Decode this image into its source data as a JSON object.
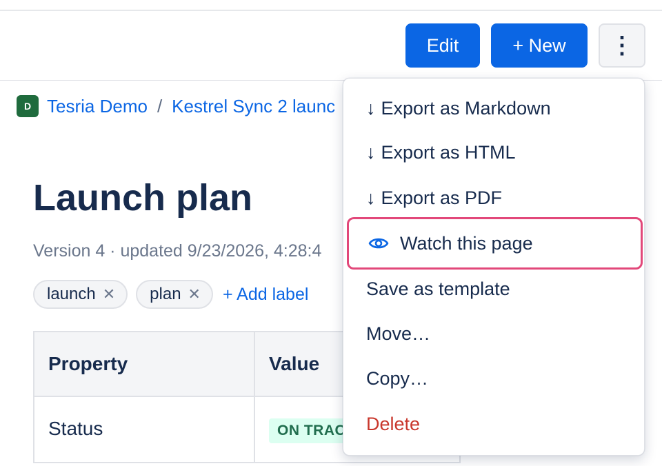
{
  "toolbar": {
    "edit_label": "Edit",
    "new_label": "+ New",
    "more_label": "⋮"
  },
  "breadcrumb": {
    "space_initial": "D",
    "space_name": "Tesria Demo",
    "separator": "/",
    "parent_page": "Kestrel Sync 2 launc"
  },
  "page": {
    "title": "Launch plan",
    "meta": "Version 4 · updated 9/23/2026, 4:28:4"
  },
  "labels": {
    "items": [
      {
        "name": "launch",
        "remove": "✕"
      },
      {
        "name": "plan",
        "remove": "✕"
      }
    ],
    "add_label": "+ Add label"
  },
  "properties": {
    "headers": [
      "Property",
      "Value"
    ],
    "rows": [
      {
        "property": "Status",
        "value": "ON TRAC"
      }
    ]
  },
  "menu": {
    "items": [
      {
        "prefix": "↓",
        "label": "Export as Markdown"
      },
      {
        "prefix": "↓",
        "label": "Export as HTML"
      },
      {
        "prefix": "↓",
        "label": "Export as PDF"
      },
      {
        "icon": "eye-icon",
        "label": "Watch this page"
      },
      {
        "label": "Save as template"
      },
      {
        "label": "Move…"
      },
      {
        "label": "Copy…"
      },
      {
        "label": "Delete",
        "danger": true
      }
    ],
    "focus_ring_color": "#e2487a",
    "danger_color": "#c9372c"
  },
  "colors": {
    "primary": "#0b66e4",
    "space_avatar": "#1f6b3d",
    "status_bg": "#dcfff1",
    "status_text": "#216e4e"
  }
}
